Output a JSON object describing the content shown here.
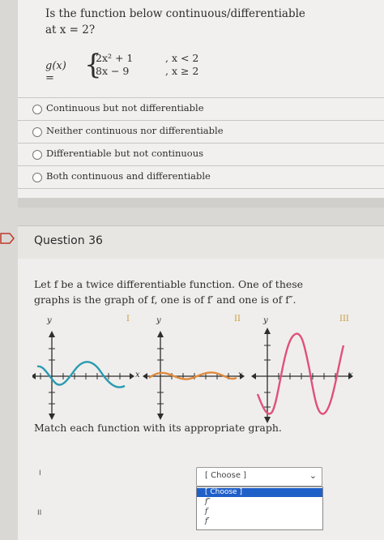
{
  "q35": {
    "line1": "Is the function below continuous/differentiable",
    "line2": "at x = 2?",
    "g_label": "g(x) =",
    "case1_expr": "2x² + 1",
    "case1_cond": ", x < 2",
    "case2_expr": "8x − 9",
    "case2_cond": ", x ≥ 2",
    "options": [
      "Continuous but not differentiable",
      "Neither continuous nor differentiable",
      "Differentiable but not continuous",
      "Both continuous and differentiable"
    ]
  },
  "q36": {
    "title": "Question 36",
    "line1": "Let f be a twice differentiable function. One of these",
    "line2": "graphs is the graph of f, one is of f′ and one is of f″.",
    "graph_labels": [
      "I",
      "II",
      "III"
    ],
    "axis_y": "y",
    "axis_x": "x",
    "match_text": "Match each function with its appropriate graph.",
    "rows": [
      "I",
      "II"
    ],
    "select_value": "[ Choose ]",
    "dropdown_options": [
      "[ Choose ]",
      "f″",
      "f",
      "f′"
    ]
  },
  "colors": {
    "graph1": "#2a9bb0",
    "graph2": "#e08a3c",
    "graph3": "#e0507a",
    "roman": "#c89a3a",
    "select_highlight": "#1f5fc8"
  }
}
